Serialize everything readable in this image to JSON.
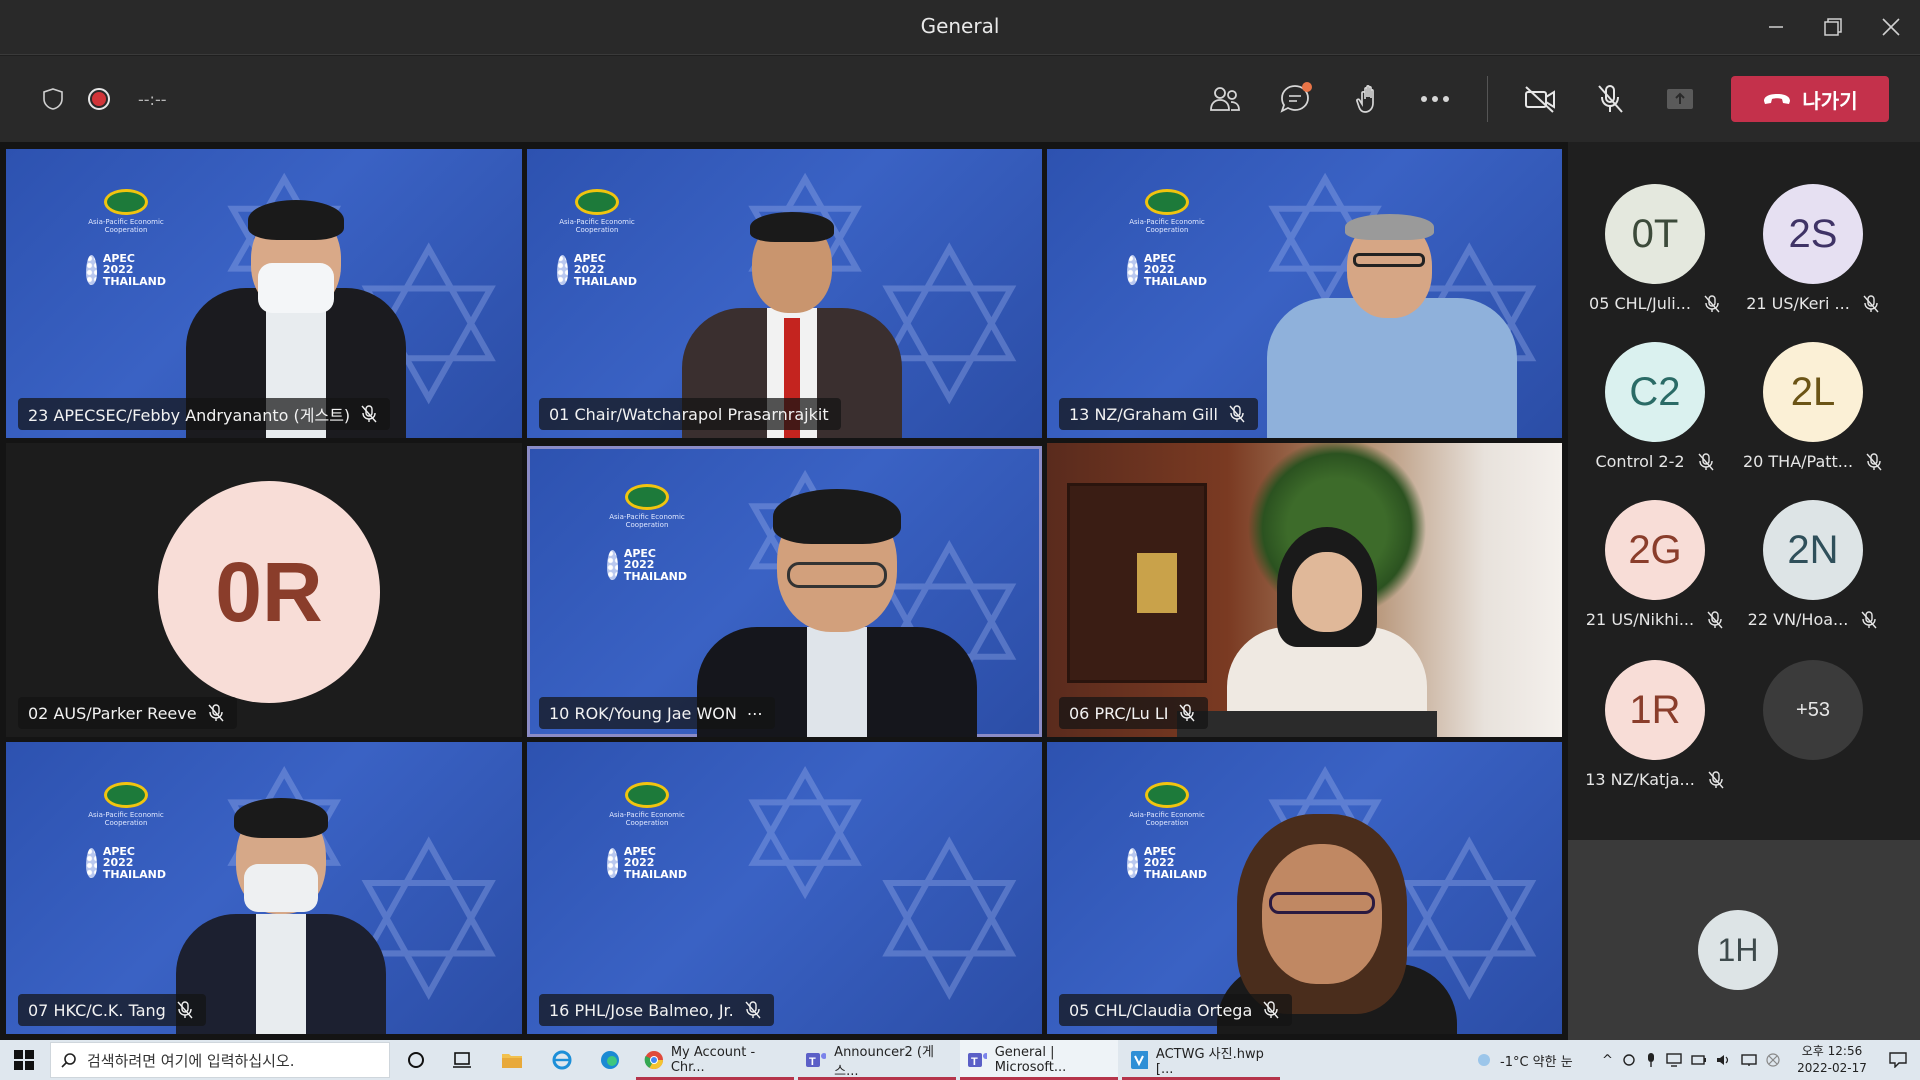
{
  "window": {
    "title": "General"
  },
  "toolbar": {
    "timer": "--:--",
    "leave_label": "나가기"
  },
  "tiles": [
    {
      "name": "23 APECSEC/Febby Andryananto (게스트)"
    },
    {
      "name": "01 Chair/Watcharapol Prasarnrajkit"
    },
    {
      "name": "13 NZ/Graham Gill"
    },
    {
      "name": "02 AUS/Parker Reeve",
      "initials": "0R"
    },
    {
      "name": "10 ROK/Young Jae WON",
      "more": "⋯"
    },
    {
      "name": "06 PRC/Lu LI"
    },
    {
      "name": "07 HKC/C.K. Tang"
    },
    {
      "name": "16 PHL/Jose Balmeo, Jr."
    },
    {
      "name": "05 CHL/Claudia Ortega"
    }
  ],
  "apec_logo": {
    "apec": "APEC",
    "sub": "Asia-Pacific Economic Cooperation",
    "year": "APEC 2022 THAILAND"
  },
  "roster": [
    {
      "initials": "0T",
      "name": "05 CHL/Juli...",
      "bg": "#e4e8de",
      "fg": "#3c4a3a"
    },
    {
      "initials": "2S",
      "name": "21 US/Keri ...",
      "bg": "#e6e0f2",
      "fg": "#3f3366"
    },
    {
      "initials": "C2",
      "name": "Control 2-2",
      "bg": "#daf1ef",
      "fg": "#2a6b66"
    },
    {
      "initials": "2L",
      "name": "20 THA/Patt...",
      "bg": "#fbf0d6",
      "fg": "#6b5416"
    },
    {
      "initials": "2G",
      "name": "21 US/Nikhi...",
      "bg": "#f8ddd7",
      "fg": "#8a3d2b"
    },
    {
      "initials": "2N",
      "name": "22 VN/Hoa...",
      "bg": "#dde4e6",
      "fg": "#2f4f5a"
    },
    {
      "initials": "1R",
      "name": "13 NZ/Katja...",
      "bg": "#f8ddd7",
      "fg": "#8a3d2b"
    }
  ],
  "roster_more": "+53",
  "self": {
    "initials": "1H"
  },
  "taskbar": {
    "search_placeholder": "검색하려면 여기에 입력하십시오.",
    "apps": [
      {
        "label": "My Account - Chr..."
      },
      {
        "label": "Announcer2 (게스..."
      },
      {
        "label": "General | Microsoft..."
      },
      {
        "label": "ACTWG 사진.hwp [..."
      }
    ],
    "weather": "-1°C  약한 눈",
    "clock_time": "오후 12:56",
    "clock_date": "2022-02-17"
  },
  "colors": {
    "leave": "#c4314b",
    "selected_outline": "#8b8cc7",
    "taskbar_underline": "#b5344a"
  }
}
